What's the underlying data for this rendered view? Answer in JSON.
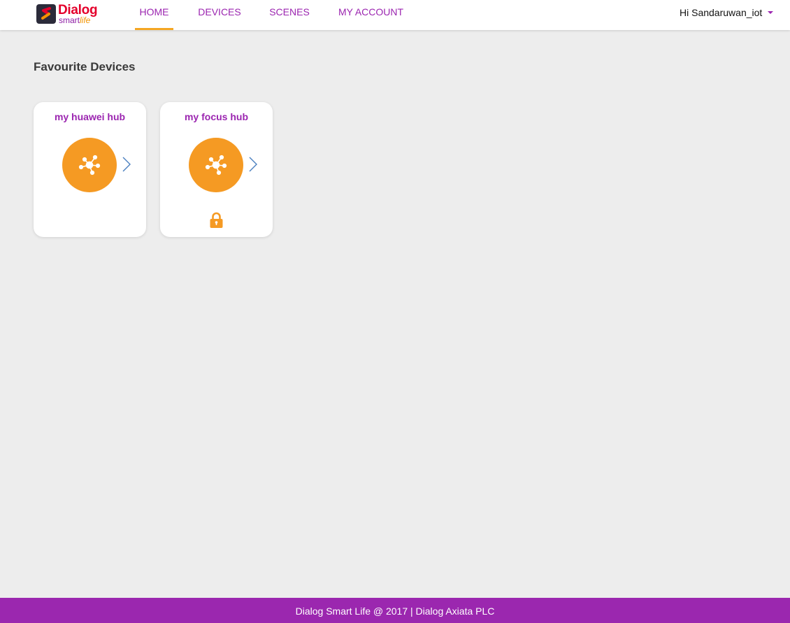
{
  "brand": {
    "name": "Dialog",
    "sub_smart": "smart",
    "sub_life": "life"
  },
  "nav": {
    "tabs": [
      {
        "label": "HOME",
        "active": true
      },
      {
        "label": "DEVICES",
        "active": false
      },
      {
        "label": "SCENES",
        "active": false
      },
      {
        "label": "MY ACCOUNT",
        "active": false
      }
    ]
  },
  "user": {
    "greeting": "Hi Sandaruwan_iot",
    "menu_icon": "caret-down-icon"
  },
  "main": {
    "title": "Favourite Devices",
    "devices": [
      {
        "name": "my huawei hub",
        "icon": "hub-icon",
        "locked": false
      },
      {
        "name": "my focus hub",
        "icon": "hub-icon",
        "locked": true
      }
    ]
  },
  "footer": {
    "text": "Dialog Smart Life @ 2017 | Dialog Axiata PLC"
  },
  "colors": {
    "accent_purple": "#9b25b0",
    "accent_orange": "#f59a23",
    "background": "#ededed",
    "footer_bg": "#9b27af"
  }
}
